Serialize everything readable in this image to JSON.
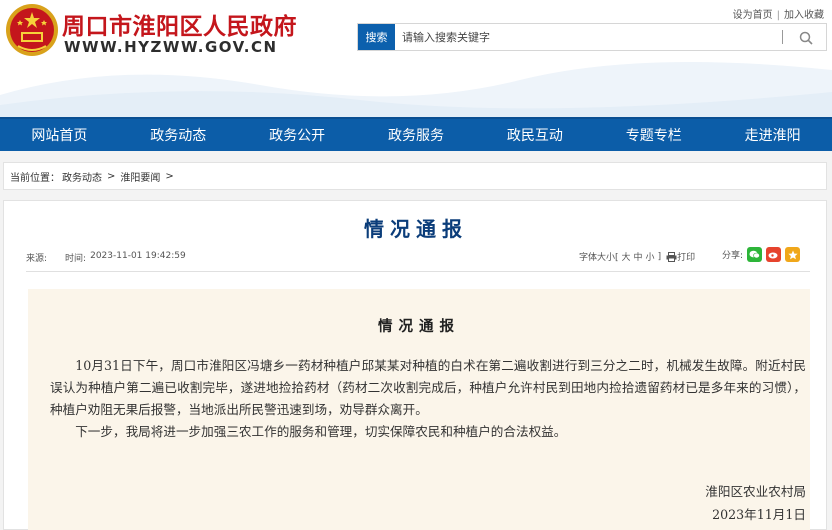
{
  "header": {
    "site_name": "周口市淮阳区人民政府",
    "site_url": "WWW.HYZWW.GOV.CN",
    "top_links": [
      "设为首页",
      "加入收藏"
    ],
    "search": {
      "button_label": "搜索",
      "placeholder": "请输入搜索关键字"
    }
  },
  "nav": {
    "items": [
      "网站首页",
      "政务动态",
      "政务公开",
      "政务服务",
      "政民互动",
      "专题专栏",
      "走进淮阳"
    ]
  },
  "breadcrumb": {
    "label": "当前位置：",
    "items": [
      "政务动态",
      "淮阳要闻"
    ],
    "separator": ">"
  },
  "article": {
    "title": "情况通报",
    "source_label": "来源:",
    "time_label": "时间:",
    "time_value": "2023-11-01 19:42:59",
    "font_size_label": "字体大小[",
    "font_sizes": [
      "大",
      "中",
      "小"
    ],
    "font_size_close": "]",
    "print_label": "打印",
    "share_label": "分享:",
    "share_icons": [
      "wechat-icon",
      "weibo-icon",
      "favorite-icon"
    ],
    "content_title": "情况通报",
    "paragraphs": [
      "10月31日下午，周口市淮阳区冯塘乡一药材种植户邱某某对种植的白术在第二遍收割进行到三分之二时，机械发生故障。附近村民误认为种植户第二遍已收割完毕，遂进地捡拾药材（药材二次收割完成后，种植户允许村民到田地内捡拾遗留药材已是多年来的习惯），种植户劝阻无果后报警，当地派出所民警迅速到场，劝导群众离开。",
      "下一步，我局将进一步加强三农工作的服务和管理，切实保障农民和种植户的合法权益。"
    ],
    "signature": "淮阳区农业农村局",
    "date": "2023年11月1日"
  },
  "colors": {
    "brand_red": "#c4161c",
    "nav_blue": "#0c5da8",
    "title_blue": "#0b3d7a",
    "content_bg": "#fbf5ea"
  }
}
